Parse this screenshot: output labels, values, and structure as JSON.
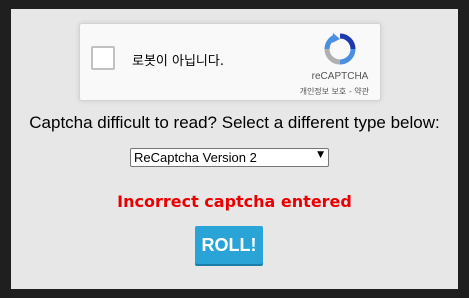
{
  "recaptcha": {
    "label": "로봇이 아닙니다.",
    "brand": "reCAPTCHA",
    "privacy": "개인정보 보호",
    "separator": " - ",
    "terms": "약관",
    "logo_icon": "recaptcha-logo-icon",
    "colors": {
      "blue": "#4a90e2",
      "dark_blue": "#1c3aa9",
      "gray": "#b0b0b0"
    }
  },
  "prompt": "Captcha difficult to read? Select a different type below:",
  "captcha_type_select": {
    "selected": "ReCaptcha Version 2",
    "arrow_icon": "dropdown-arrow-icon"
  },
  "error_message": "Incorrect captcha entered",
  "roll_button": {
    "label": "ROLL!"
  },
  "colors": {
    "background": "#e7e7e7",
    "outer_frame": "#1f1f1f",
    "error": "#ea0000",
    "button": "#2aa3d7"
  }
}
